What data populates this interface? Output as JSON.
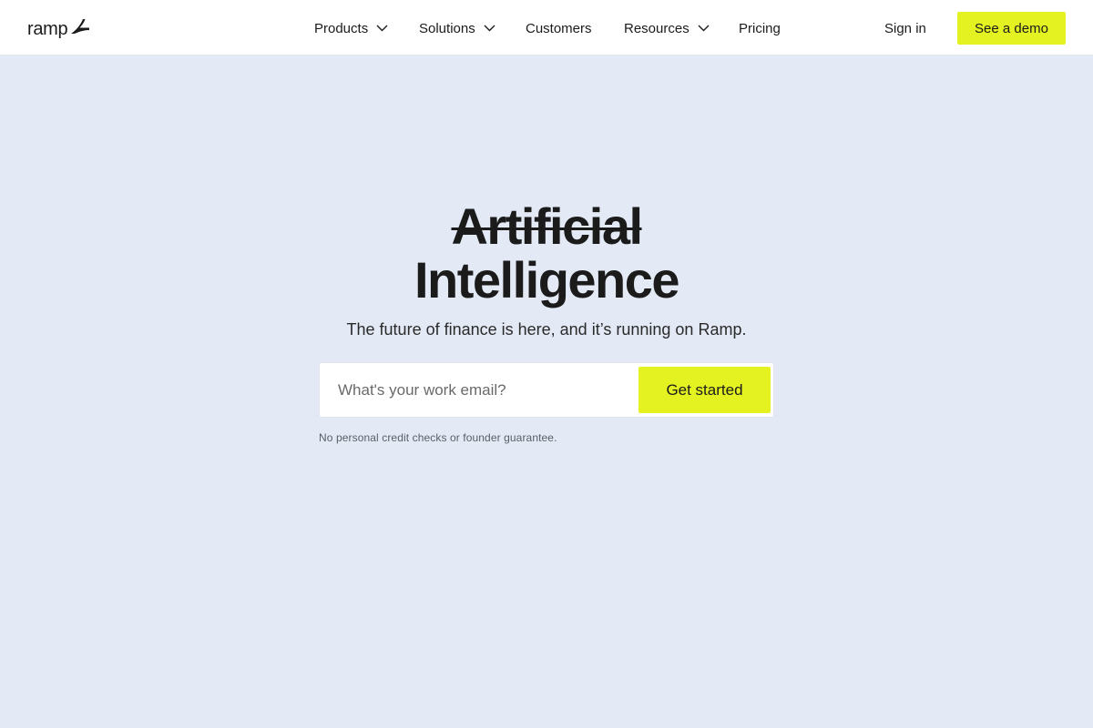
{
  "nav": {
    "logo_text": "ramp",
    "logo_icon": "ramp-bird-icon",
    "items": [
      {
        "label": "Products",
        "has_dropdown": true
      },
      {
        "label": "Solutions",
        "has_dropdown": true
      },
      {
        "label": "Customers",
        "has_dropdown": false
      },
      {
        "label": "Resources",
        "has_dropdown": true
      },
      {
        "label": "Pricing",
        "has_dropdown": false
      }
    ],
    "signin_label": "Sign in",
    "demo_label": "See a demo"
  },
  "hero": {
    "strike_text": "Artificial",
    "title": "Intelligence",
    "subtitle": "The future of finance is here, and it’s running on Ramp.",
    "email_placeholder": "What's your work email?",
    "email_value": "",
    "cta_label": "Get started",
    "disclaimer": "No personal credit checks or founder guarantee."
  },
  "colors": {
    "accent": "#e4f222",
    "background": "#e3eaf5",
    "text": "#1b1b1b"
  }
}
